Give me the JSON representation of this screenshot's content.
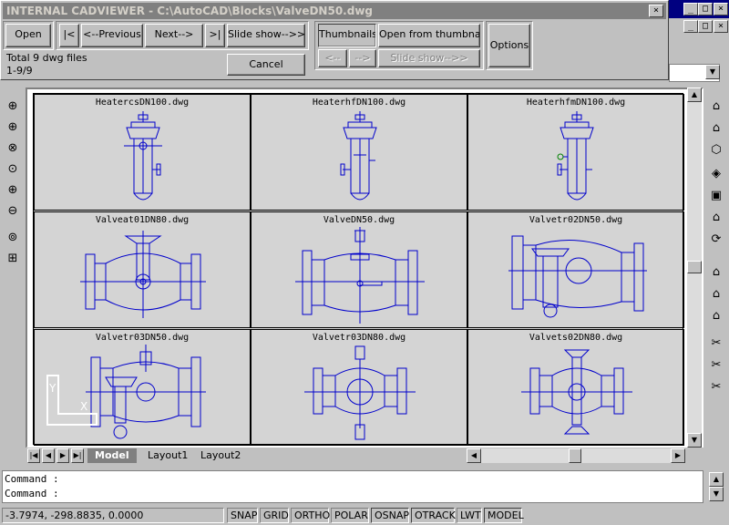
{
  "dialog": {
    "title": "INTERNAL CADVIEWER - C:\\AutoCAD\\Blocks\\ValveDN50.dwg",
    "close_glyph": "✕",
    "buttons": {
      "open": "Open",
      "first": "|<",
      "previous": "<--Previous",
      "next": "Next-->",
      "last": ">|",
      "slideshow": "Slide show-->>",
      "thumbnails": "Thumbnails",
      "open_thumbnail": "Open from thumbnail",
      "options": "Options",
      "cancel": "Cancel",
      "thumb_prev": "<--",
      "thumb_next": "-->",
      "thumb_slideshow": "Slide show-->>"
    },
    "total_text": "Total 9 dwg files",
    "range_text": "1-9/9"
  },
  "thumbnails": [
    {
      "label": "HeatercsDN100.dwg"
    },
    {
      "label": "HeaterhfDN100.dwg"
    },
    {
      "label": "HeaterhfmDN100.dwg"
    },
    {
      "label": "Valveat01DN80.dwg"
    },
    {
      "label": "ValveDN50.dwg"
    },
    {
      "label": "Valvetr02DN50.dwg"
    },
    {
      "label": "Valvetr03DN50.dwg"
    },
    {
      "label": "Valvetr03DN80.dwg"
    },
    {
      "label": "Valvets02DN80.dwg"
    }
  ],
  "tabs": {
    "model": "Model",
    "layout1": "Layout1",
    "layout2": "Layout2"
  },
  "command": {
    "line1": "Command :",
    "line2": "Command :"
  },
  "status": {
    "coords": "-3.7974, -298.8835, 0.0000",
    "snap": "SNAP",
    "grid": "GRID",
    "ortho": "ORTHO",
    "polar": "POLAR",
    "osnap": "OSNAP",
    "otrack": "OTRACK",
    "lwt": "LWT",
    "model": "MODEL"
  },
  "colors": {
    "drawing_line": "#0000cc",
    "title_bar": "#808080",
    "acad_title": "#000080"
  }
}
